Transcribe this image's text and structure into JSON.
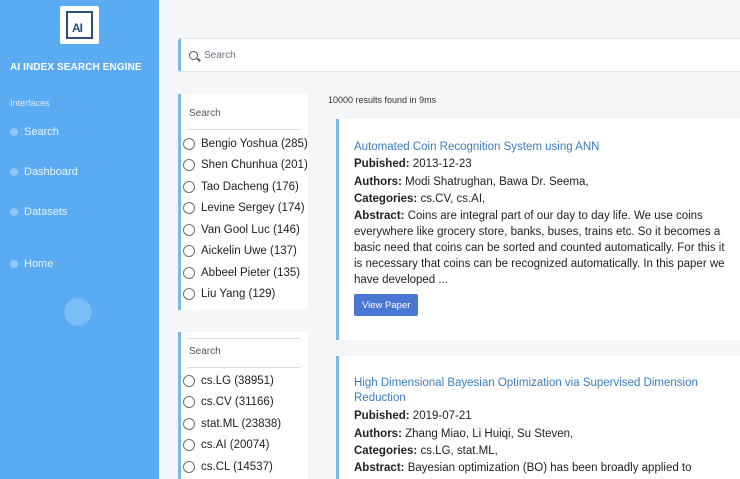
{
  "sidebar": {
    "logo_text": "AI",
    "brand": "AI INDEX SEARCH ENGINE",
    "section_label": "Interfaces",
    "nav": [
      {
        "label": "Search",
        "icon": "search-icon"
      },
      {
        "label": "Dashboard",
        "icon": "dashboard-icon"
      },
      {
        "label": "Datasets",
        "icon": "datasets-icon"
      },
      {
        "label": "Home",
        "icon": "home-icon"
      }
    ]
  },
  "search": {
    "placeholder": "Search"
  },
  "authors_facet": {
    "placeholder": "Search",
    "items": [
      "Bengio Yoshua (285)",
      "Shen Chunhua (201)",
      "Tao Dacheng (176)",
      "Levine Sergey (174)",
      "Van Gool Luc (146)",
      "Aickelin Uwe (137)",
      "Abbeel Pieter (135)",
      "Liu Yang (129)"
    ]
  },
  "categories_facet": {
    "placeholder": "Search",
    "items": [
      "cs.LG (38951)",
      "cs.CV (31166)",
      "stat.ML (23838)",
      "cs.AI (20074)",
      "cs.CL (14537)"
    ]
  },
  "results": {
    "count_text": "10000 results found in 9ms",
    "labels": {
      "published": "Pubished:",
      "authors": "Authors:",
      "categories": "Categories:",
      "abstract": "Abstract:"
    },
    "items": [
      {
        "title": "Automated Coin Recognition System using ANN",
        "published": "2013-12-23",
        "authors": "Modi Shatrughan, Bawa Dr. Seema,",
        "categories": "cs.CV, cs.AI,",
        "abstract_lines": [
          "Coins are integral part of our day to day life. We use coins",
          "everywhere like grocery store, banks, buses, trains etc. So it becomes a",
          "basic need that coins can be sorted and counted automatically. For this it",
          "is necessary that coins can be recognized automatically. In this paper we",
          "have developed ..."
        ],
        "button": "View Paper"
      },
      {
        "title": "High Dimensional Bayesian Optimization via Supervised Dimension Reduction",
        "published": "2019-07-21",
        "authors": "Zhang Miao, Li Huiqi, Su Steven,",
        "categories": "cs.LG, stat.ML,",
        "abstract_lines": [
          "Bayesian optimization (BO) has been broadly applied to"
        ]
      }
    ]
  },
  "colors": {
    "sidebar": "#5aabf2",
    "accent": "#7db8e8",
    "link": "#3d7cc1",
    "button": "#4a77d4"
  }
}
